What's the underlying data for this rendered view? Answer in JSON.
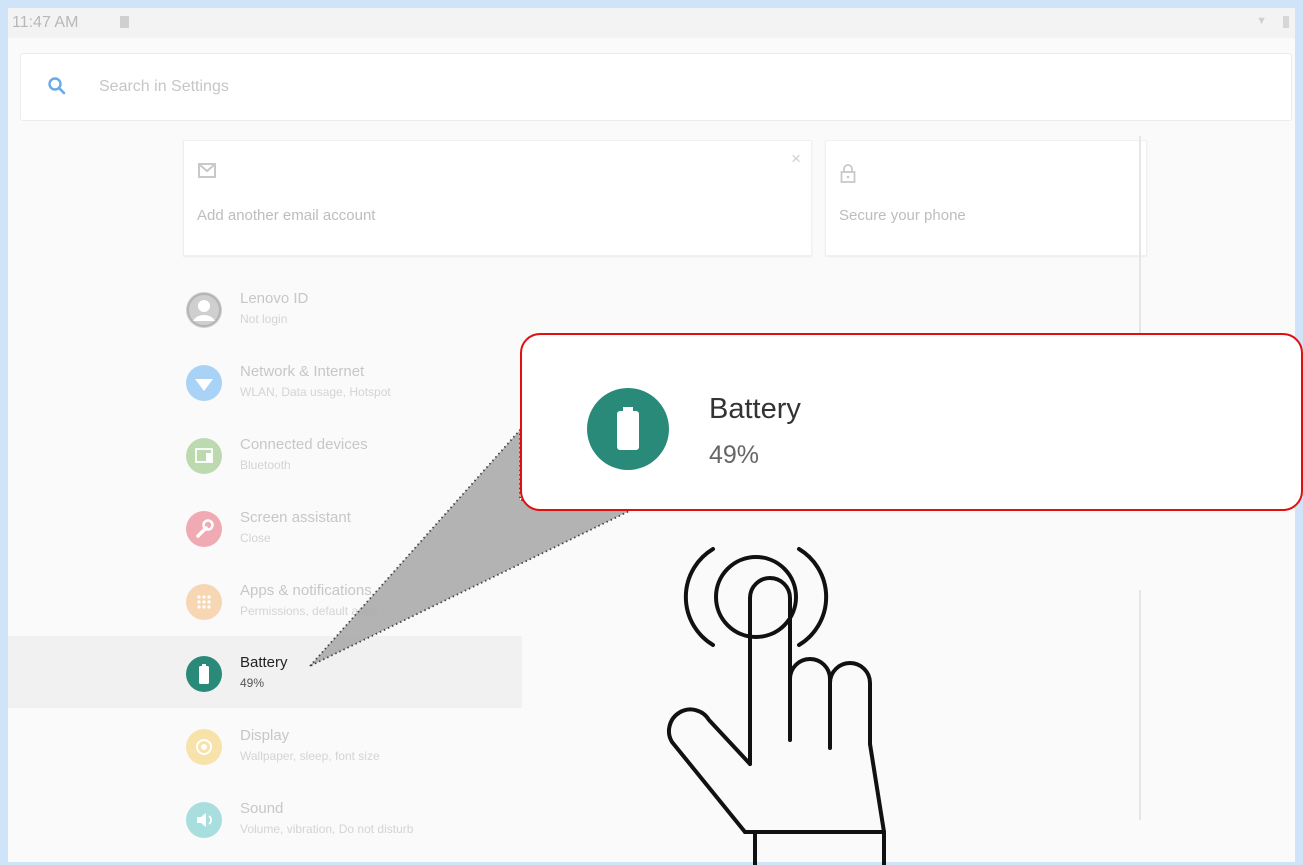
{
  "status_bar": {
    "time": "11:47 AM"
  },
  "search": {
    "placeholder": "Search in Settings"
  },
  "cards": [
    {
      "title": "Add another email account",
      "icon": "email-icon",
      "close": "×"
    },
    {
      "title": "Secure your phone",
      "icon": "lock-icon"
    }
  ],
  "settings": [
    {
      "title": "Lenovo ID",
      "subtitle": "Not login",
      "icon": "account-icon",
      "color": "#c9c9c9"
    },
    {
      "title": "Network & Internet",
      "subtitle": "WLAN, Data usage, Hotspot",
      "icon": "wifi-icon",
      "color": "#a8d3f7"
    },
    {
      "title": "Connected devices",
      "subtitle": "Bluetooth",
      "icon": "devices-icon",
      "color": "#bcd9b0"
    },
    {
      "title": "Screen assistant",
      "subtitle": "Close",
      "icon": "wrench-icon",
      "color": "#f0aab3"
    },
    {
      "title": "Apps & notifications",
      "subtitle": "Permissions, default apps",
      "icon": "apps-grid-icon",
      "color": "#f7d6b4"
    },
    {
      "title": "Battery",
      "subtitle": "49%",
      "icon": "battery-icon",
      "color": "#2a8a7a"
    },
    {
      "title": "Display",
      "subtitle": "Wallpaper, sleep, font size",
      "icon": "brightness-icon",
      "color": "#f7e2a9"
    },
    {
      "title": "Sound",
      "subtitle": "Volume, vibration, Do not disturb",
      "icon": "volume-icon",
      "color": "#a9dede"
    }
  ],
  "zoom": {
    "title": "Battery",
    "subtitle": "49%",
    "icon": "battery-icon",
    "highlight_color": "#e20f0f"
  },
  "overlay": {
    "icon": "tap-hand-icon"
  }
}
